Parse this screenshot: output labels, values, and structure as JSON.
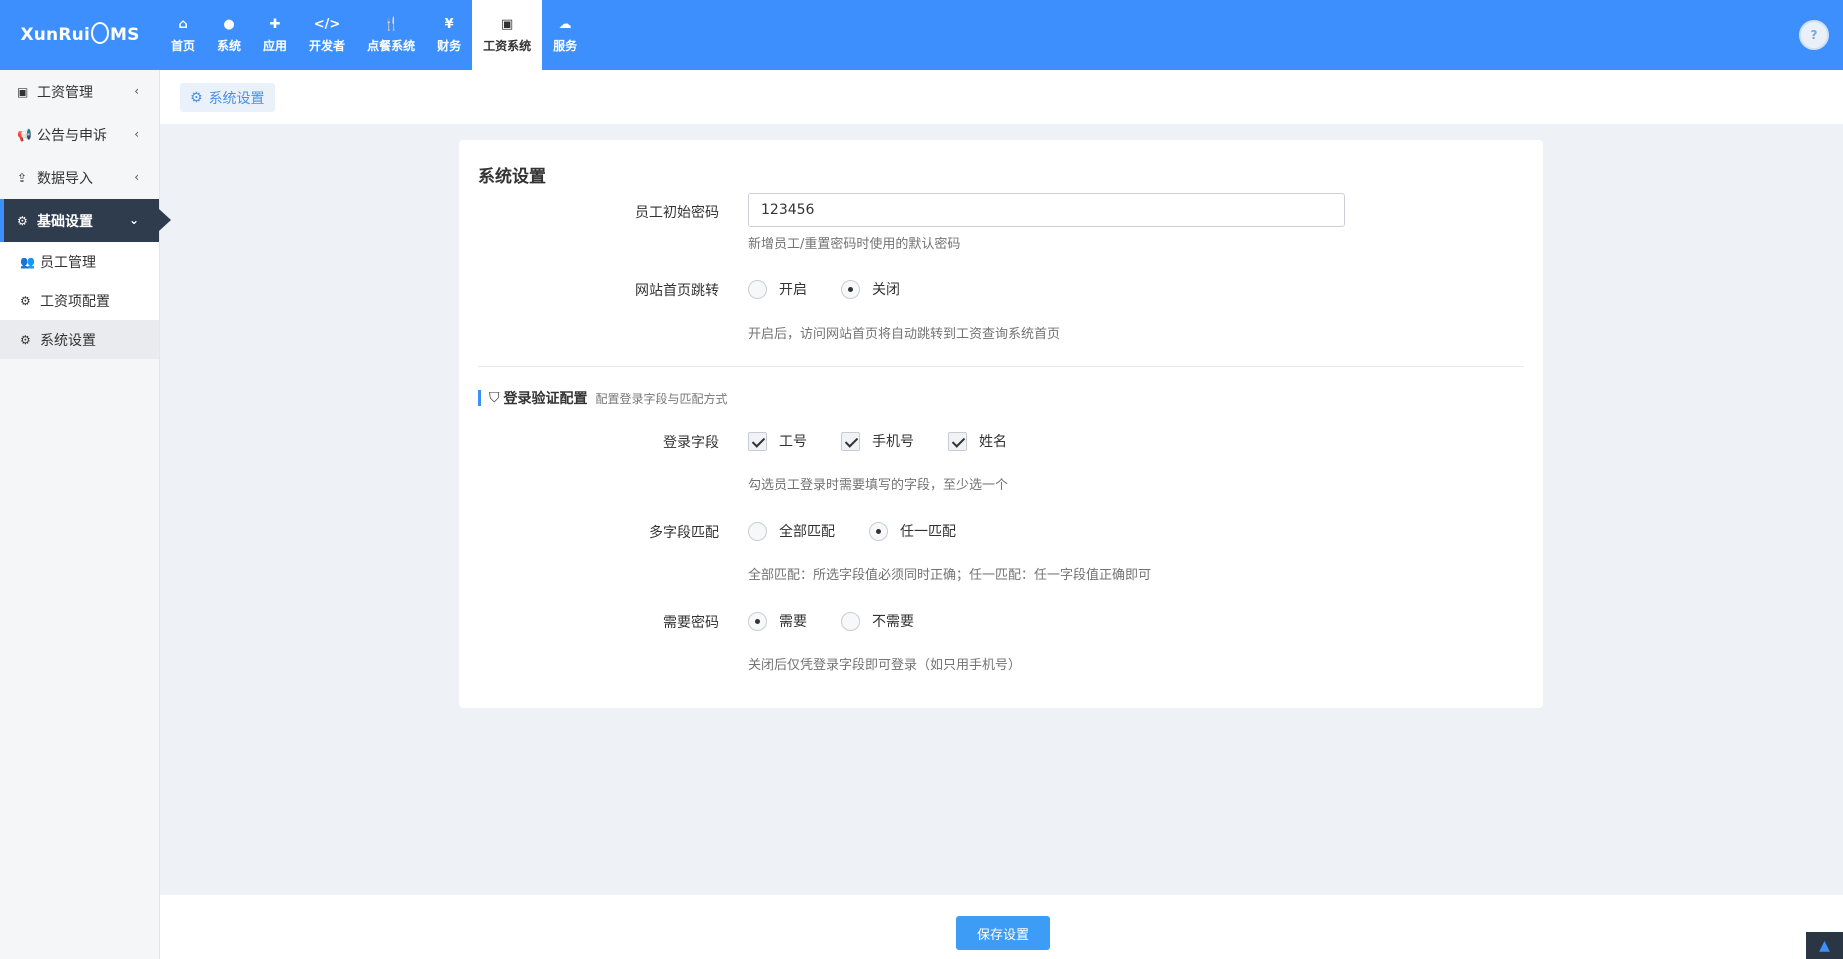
{
  "brand": {
    "logo_prefix": "XunRui",
    "logo_suffix": "MS"
  },
  "nav": [
    {
      "label": "首页",
      "icon": "⌂"
    },
    {
      "label": "系统",
      "icon": "●"
    },
    {
      "label": "应用",
      "icon": "✚"
    },
    {
      "label": "开发者",
      "icon": "</>"
    },
    {
      "label": "点餐系统",
      "icon": "🍴"
    },
    {
      "label": "财务",
      "icon": "¥"
    },
    {
      "label": "工资系统",
      "icon": "▣"
    },
    {
      "label": "服务",
      "icon": "☁"
    }
  ],
  "user": {
    "avatar_text": "?"
  },
  "sidebar": {
    "items": [
      {
        "label": "工资管理",
        "icon": "▣",
        "chevron": "‹"
      },
      {
        "label": "公告与申诉",
        "icon": "📢",
        "chevron": "‹"
      },
      {
        "label": "数据导入",
        "icon": "⇪",
        "chevron": "‹"
      },
      {
        "label": "基础设置",
        "icon": "⚙",
        "chevron": "⌄"
      }
    ],
    "sub_items": [
      {
        "label": "员工管理",
        "icon": "👥"
      },
      {
        "label": "工资项配置",
        "icon": "⚙"
      },
      {
        "label": "系统设置",
        "icon": "⚙"
      }
    ]
  },
  "breadcrumb": {
    "icon": "⚙",
    "label": "系统设置"
  },
  "form": {
    "title": "系统设置",
    "init_password": {
      "label": "员工初始密码",
      "value": "123456",
      "help": "新增员工/重置密码时使用的默认密码"
    },
    "redirect": {
      "label": "网站首页跳转",
      "options": [
        "开启",
        "关闭"
      ],
      "selected": "关闭",
      "help": "开启后，访问网站首页将自动跳转到工资查询系统首页"
    },
    "section": {
      "icon": "⛉",
      "title": "登录验证配置",
      "subtitle": "配置登录字段与匹配方式"
    },
    "login_fields": {
      "label": "登录字段",
      "options": [
        "工号",
        "手机号",
        "姓名"
      ],
      "checked": [
        "工号",
        "手机号",
        "姓名"
      ],
      "help": "勾选员工登录时需要填写的字段，至少选一个"
    },
    "match_mode": {
      "label": "多字段匹配",
      "options": [
        "全部匹配",
        "任一匹配"
      ],
      "selected": "任一匹配",
      "help": "全部匹配：所选字段值必须同时正确；任一匹配：任一字段值正确即可"
    },
    "need_password": {
      "label": "需要密码",
      "options": [
        "需要",
        "不需要"
      ],
      "selected": "需要",
      "help": "关闭后仅凭登录字段即可登录（如只用手机号）"
    }
  },
  "footer": {
    "save_label": "保存设置"
  }
}
